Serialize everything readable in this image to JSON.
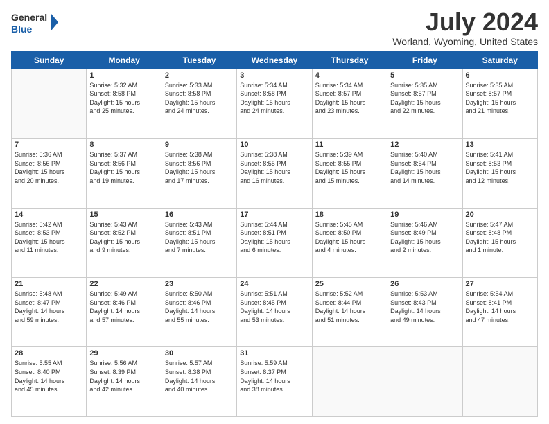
{
  "header": {
    "logo_general": "General",
    "logo_blue": "Blue",
    "month": "July 2024",
    "location": "Worland, Wyoming, United States"
  },
  "weekdays": [
    "Sunday",
    "Monday",
    "Tuesday",
    "Wednesday",
    "Thursday",
    "Friday",
    "Saturday"
  ],
  "weeks": [
    [
      {
        "day": "",
        "info": ""
      },
      {
        "day": "1",
        "info": "Sunrise: 5:32 AM\nSunset: 8:58 PM\nDaylight: 15 hours\nand 25 minutes."
      },
      {
        "day": "2",
        "info": "Sunrise: 5:33 AM\nSunset: 8:58 PM\nDaylight: 15 hours\nand 24 minutes."
      },
      {
        "day": "3",
        "info": "Sunrise: 5:34 AM\nSunset: 8:58 PM\nDaylight: 15 hours\nand 24 minutes."
      },
      {
        "day": "4",
        "info": "Sunrise: 5:34 AM\nSunset: 8:57 PM\nDaylight: 15 hours\nand 23 minutes."
      },
      {
        "day": "5",
        "info": "Sunrise: 5:35 AM\nSunset: 8:57 PM\nDaylight: 15 hours\nand 22 minutes."
      },
      {
        "day": "6",
        "info": "Sunrise: 5:35 AM\nSunset: 8:57 PM\nDaylight: 15 hours\nand 21 minutes."
      }
    ],
    [
      {
        "day": "7",
        "info": "Sunrise: 5:36 AM\nSunset: 8:56 PM\nDaylight: 15 hours\nand 20 minutes."
      },
      {
        "day": "8",
        "info": "Sunrise: 5:37 AM\nSunset: 8:56 PM\nDaylight: 15 hours\nand 19 minutes."
      },
      {
        "day": "9",
        "info": "Sunrise: 5:38 AM\nSunset: 8:56 PM\nDaylight: 15 hours\nand 17 minutes."
      },
      {
        "day": "10",
        "info": "Sunrise: 5:38 AM\nSunset: 8:55 PM\nDaylight: 15 hours\nand 16 minutes."
      },
      {
        "day": "11",
        "info": "Sunrise: 5:39 AM\nSunset: 8:55 PM\nDaylight: 15 hours\nand 15 minutes."
      },
      {
        "day": "12",
        "info": "Sunrise: 5:40 AM\nSunset: 8:54 PM\nDaylight: 15 hours\nand 14 minutes."
      },
      {
        "day": "13",
        "info": "Sunrise: 5:41 AM\nSunset: 8:53 PM\nDaylight: 15 hours\nand 12 minutes."
      }
    ],
    [
      {
        "day": "14",
        "info": "Sunrise: 5:42 AM\nSunset: 8:53 PM\nDaylight: 15 hours\nand 11 minutes."
      },
      {
        "day": "15",
        "info": "Sunrise: 5:43 AM\nSunset: 8:52 PM\nDaylight: 15 hours\nand 9 minutes."
      },
      {
        "day": "16",
        "info": "Sunrise: 5:43 AM\nSunset: 8:51 PM\nDaylight: 15 hours\nand 7 minutes."
      },
      {
        "day": "17",
        "info": "Sunrise: 5:44 AM\nSunset: 8:51 PM\nDaylight: 15 hours\nand 6 minutes."
      },
      {
        "day": "18",
        "info": "Sunrise: 5:45 AM\nSunset: 8:50 PM\nDaylight: 15 hours\nand 4 minutes."
      },
      {
        "day": "19",
        "info": "Sunrise: 5:46 AM\nSunset: 8:49 PM\nDaylight: 15 hours\nand 2 minutes."
      },
      {
        "day": "20",
        "info": "Sunrise: 5:47 AM\nSunset: 8:48 PM\nDaylight: 15 hours\nand 1 minute."
      }
    ],
    [
      {
        "day": "21",
        "info": "Sunrise: 5:48 AM\nSunset: 8:47 PM\nDaylight: 14 hours\nand 59 minutes."
      },
      {
        "day": "22",
        "info": "Sunrise: 5:49 AM\nSunset: 8:46 PM\nDaylight: 14 hours\nand 57 minutes."
      },
      {
        "day": "23",
        "info": "Sunrise: 5:50 AM\nSunset: 8:46 PM\nDaylight: 14 hours\nand 55 minutes."
      },
      {
        "day": "24",
        "info": "Sunrise: 5:51 AM\nSunset: 8:45 PM\nDaylight: 14 hours\nand 53 minutes."
      },
      {
        "day": "25",
        "info": "Sunrise: 5:52 AM\nSunset: 8:44 PM\nDaylight: 14 hours\nand 51 minutes."
      },
      {
        "day": "26",
        "info": "Sunrise: 5:53 AM\nSunset: 8:43 PM\nDaylight: 14 hours\nand 49 minutes."
      },
      {
        "day": "27",
        "info": "Sunrise: 5:54 AM\nSunset: 8:41 PM\nDaylight: 14 hours\nand 47 minutes."
      }
    ],
    [
      {
        "day": "28",
        "info": "Sunrise: 5:55 AM\nSunset: 8:40 PM\nDaylight: 14 hours\nand 45 minutes."
      },
      {
        "day": "29",
        "info": "Sunrise: 5:56 AM\nSunset: 8:39 PM\nDaylight: 14 hours\nand 42 minutes."
      },
      {
        "day": "30",
        "info": "Sunrise: 5:57 AM\nSunset: 8:38 PM\nDaylight: 14 hours\nand 40 minutes."
      },
      {
        "day": "31",
        "info": "Sunrise: 5:59 AM\nSunset: 8:37 PM\nDaylight: 14 hours\nand 38 minutes."
      },
      {
        "day": "",
        "info": ""
      },
      {
        "day": "",
        "info": ""
      },
      {
        "day": "",
        "info": ""
      }
    ]
  ]
}
